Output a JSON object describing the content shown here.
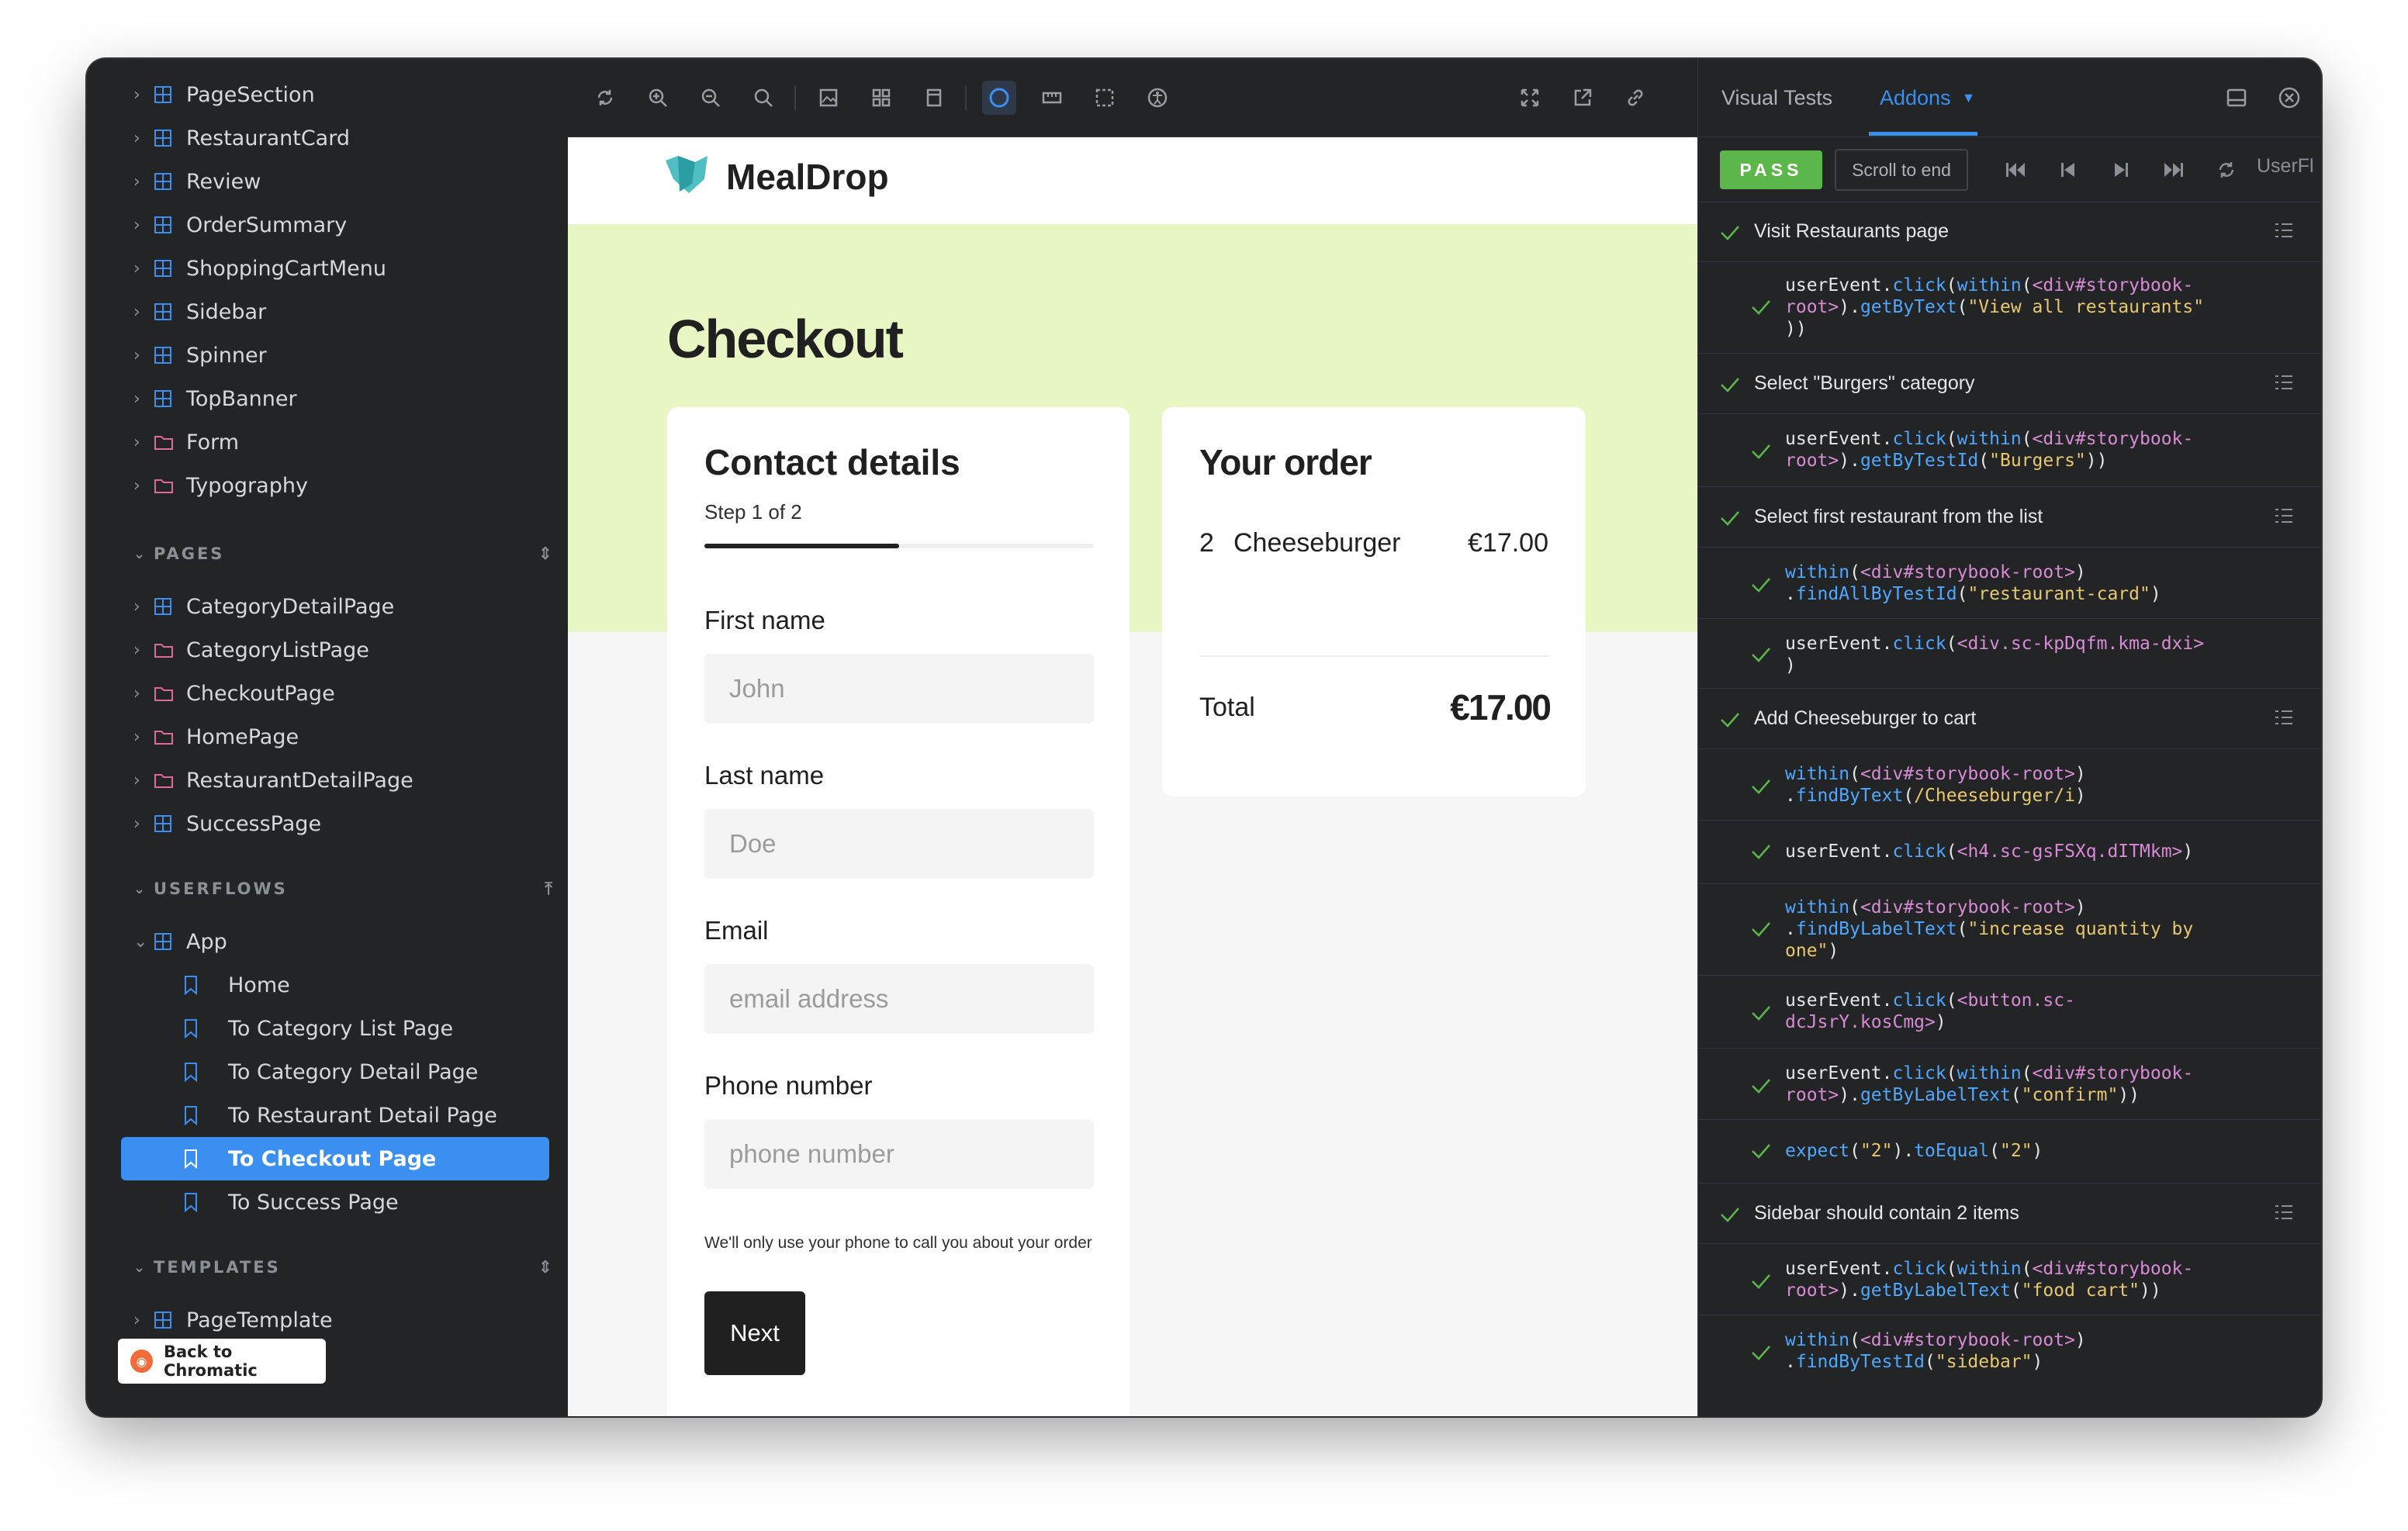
{
  "sidebar": {
    "components": [
      {
        "label": "PageSection",
        "icon": "component-icon"
      },
      {
        "label": "RestaurantCard",
        "icon": "component-icon"
      },
      {
        "label": "Review",
        "icon": "component-icon"
      },
      {
        "label": "OrderSummary",
        "icon": "component-icon"
      },
      {
        "label": "ShoppingCartMenu",
        "icon": "component-icon"
      },
      {
        "label": "Sidebar",
        "icon": "component-icon"
      },
      {
        "label": "Spinner",
        "icon": "component-icon"
      },
      {
        "label": "TopBanner",
        "icon": "component-icon"
      },
      {
        "label": "Form",
        "icon": "folder-icon"
      },
      {
        "label": "Typography",
        "icon": "folder-icon"
      }
    ],
    "pages_heading": "PAGES",
    "pages": [
      {
        "label": "CategoryDetailPage",
        "icon": "component-icon"
      },
      {
        "label": "CategoryListPage",
        "icon": "folder-icon"
      },
      {
        "label": "CheckoutPage",
        "icon": "folder-icon"
      },
      {
        "label": "HomePage",
        "icon": "folder-icon"
      },
      {
        "label": "RestaurantDetailPage",
        "icon": "folder-icon"
      },
      {
        "label": "SuccessPage",
        "icon": "component-icon"
      }
    ],
    "userflows_heading": "USERFLOWS",
    "app_label": "App",
    "stories": [
      {
        "label": "Home"
      },
      {
        "label": "To Category List Page"
      },
      {
        "label": "To Category Detail Page"
      },
      {
        "label": "To Restaurant Detail Page"
      },
      {
        "label": "To Checkout Page",
        "selected": true
      },
      {
        "label": "To Success Page"
      }
    ],
    "templates_heading": "TEMPLATES",
    "template_item": "PageTemplate",
    "back_label": "Back to Chromatic"
  },
  "preview": {
    "brand": "MealDrop",
    "title": "Checkout",
    "contact": {
      "title": "Contact details",
      "step": "Step 1 of 2",
      "progress": 0.5,
      "fields": [
        {
          "label": "First name",
          "placeholder": "John"
        },
        {
          "label": "Last name",
          "placeholder": "Doe"
        },
        {
          "label": "Email",
          "placeholder": "email address"
        },
        {
          "label": "Phone number",
          "placeholder": "phone number"
        }
      ],
      "hint": "We'll only use your phone to call you about your order",
      "next_label": "Next"
    },
    "order": {
      "title": "Your order",
      "qty": "2",
      "item": "Cheeseburger",
      "price": "€17.00",
      "total_label": "Total",
      "total_value": "€17.00"
    }
  },
  "addons": {
    "tabs": [
      "Visual Tests",
      "Addons"
    ],
    "pass_label": "PASS",
    "scroll_label": "Scroll to end",
    "user_label": "UserFl",
    "steps": [
      {
        "title": "Visit Restaurants page",
        "subs": [
          "userEvent.click(within(<div#storybook-root>).getByText(\"View all restaurants\"))"
        ]
      },
      {
        "title": "Select \"Burgers\" category",
        "subs": [
          "userEvent.click(within(<div#storybook-root>).getByTestId(\"Burgers\"))"
        ]
      },
      {
        "title": "Select first restaurant from the list",
        "subs": [
          "within(<div#storybook-root>).findAllByTestId(\"restaurant-card\")",
          "userEvent.click(<div.sc-kpDqfm.kma-dxi>)"
        ]
      },
      {
        "title": "Add Cheeseburger to cart",
        "subs": [
          "within(<div#storybook-root>).findByText(/Cheeseburger/i)",
          "userEvent.click(<h4.sc-gsFSXq.dITMkm>)",
          "within(<div#storybook-root>).findByLabelText(\"increase quantity by one\")",
          "userEvent.click(<button.sc-dcJsrY.kosCmg>)",
          "userEvent.click(within(<div#storybook-root>).getByLabelText(\"confirm\"))",
          "expect(\"2\").toEqual(\"2\")"
        ]
      },
      {
        "title": "Sidebar should contain 2 items",
        "subs": [
          "userEvent.click(within(<div#storybook-root>).getByLabelText(\"food cart\"))",
          "within(<div#storybook-root>).findByTestId(\"sidebar\")"
        ]
      }
    ]
  },
  "colors": {
    "accent": "#3b8ff0",
    "pass": "#5cb74b",
    "hero": "#e8f6c4",
    "sidebar_bg": "#222425",
    "component_icon": "#3b8ff0",
    "folder_icon": "#e0689a",
    "story_icon": "#3b8ff0"
  }
}
